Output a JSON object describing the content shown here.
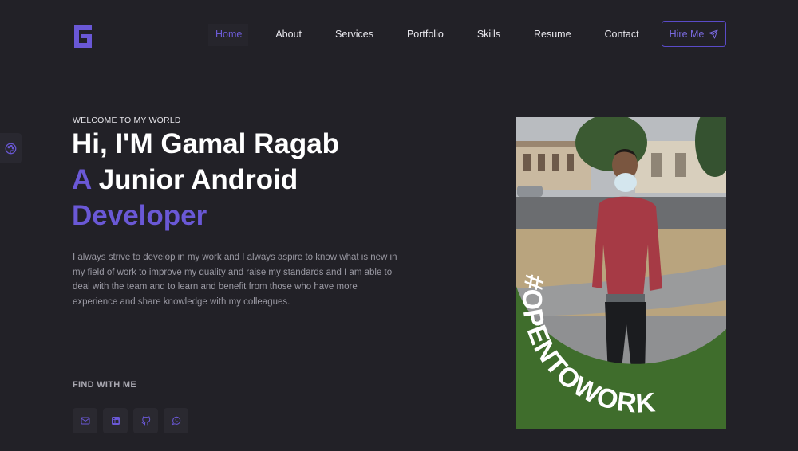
{
  "header": {
    "logo_icon": "g-monogram-logo",
    "nav": [
      {
        "label": "Home",
        "active": true
      },
      {
        "label": "About"
      },
      {
        "label": "Services"
      },
      {
        "label": "Portfolio"
      },
      {
        "label": "Skills"
      },
      {
        "label": "Resume"
      },
      {
        "label": "Contact"
      }
    ],
    "hire_label": "Hire Me",
    "hire_icon": "paper-plane-icon"
  },
  "side_widget": {
    "icon": "palette-icon"
  },
  "hero": {
    "welcome": "WELCOME TO MY WORLD",
    "title_line1": "Hi, I'M Gamal Ragab",
    "title_accent": "A",
    "title_line2_rest": " Junior Android",
    "title_line3": "Developer",
    "description": "I always strive to develop in my work and I always aspire to know what is new in my field of work to improve my quality and raise my standards and I am able to deal with the team and to learn and benefit from those who have more experience and share knowledge with my colleagues."
  },
  "find": {
    "label": "FIND WITH ME",
    "socials": [
      {
        "icon": "mail-icon"
      },
      {
        "icon": "linkedin-icon"
      },
      {
        "icon": "github-icon"
      },
      {
        "icon": "whatsapp-icon"
      }
    ]
  },
  "photo": {
    "frame_text": "#OPENTOWORK"
  },
  "colors": {
    "background": "#222127",
    "accent": "#6a58d6",
    "frame_green": "#3f6d2c"
  }
}
